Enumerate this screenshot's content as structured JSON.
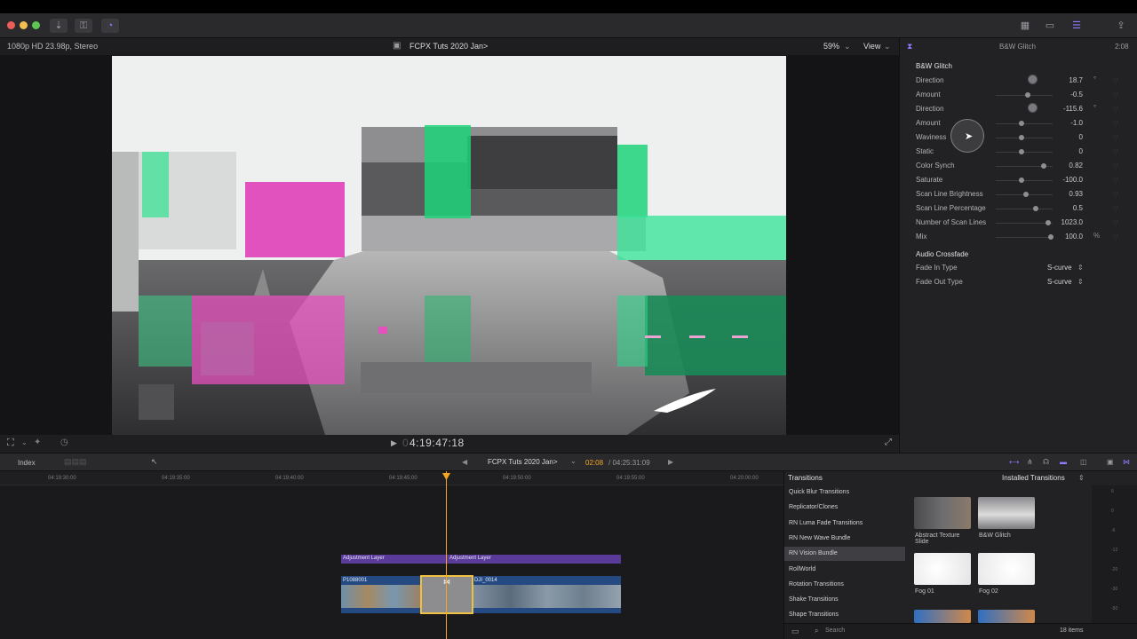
{
  "viewer": {
    "format": "1080p HD 23.98p, Stereo",
    "project_title": "FCPX Tuts 2020 Jan>",
    "zoom": "59%",
    "view_label": "View",
    "timecode": "4:19:47:18",
    "timecode_prefix": "0"
  },
  "inspector": {
    "title": "B&W Glitch",
    "duration": "2:08",
    "effect_name": "B&W Glitch",
    "params": [
      {
        "label": "Direction",
        "value": "18.7",
        "unit": "°",
        "control": "dial"
      },
      {
        "label": "Amount",
        "value": "-0.5",
        "unit": "",
        "control": "slider",
        "pos": 0.65
      },
      {
        "label": "Direction",
        "value": "-115.6",
        "unit": "°",
        "control": "dial"
      },
      {
        "label": "Amount",
        "value": "-1.0",
        "unit": "",
        "control": "slider",
        "pos": 0.5
      },
      {
        "label": "Waviness",
        "value": "0",
        "unit": "",
        "control": "slider",
        "pos": 0.5
      },
      {
        "label": "Static",
        "value": "0",
        "unit": "",
        "control": "slider",
        "pos": 0.5
      },
      {
        "label": "Color Synch",
        "value": "0.82",
        "unit": "",
        "control": "slider",
        "pos": 1.0
      },
      {
        "label": "Saturate",
        "value": "-100.0",
        "unit": "",
        "control": "slider",
        "pos": 0.5
      },
      {
        "label": "Scan Line Brightness",
        "value": "0.93",
        "unit": "",
        "control": "slider",
        "pos": 0.6
      },
      {
        "label": "Scan Line Percentage",
        "value": "0.5",
        "unit": "",
        "control": "slider",
        "pos": 0.83
      },
      {
        "label": "Number of Scan Lines",
        "value": "1023.0",
        "unit": "",
        "control": "slider",
        "pos": 1.1
      },
      {
        "label": "Mix",
        "value": "100.0",
        "unit": "%",
        "control": "slider",
        "pos": 1.15
      }
    ],
    "audio_section": "Audio Crossfade",
    "fade_in_label": "Fade In Type",
    "fade_in_value": "S-curve",
    "fade_out_label": "Fade Out Type",
    "fade_out_value": "S-curve"
  },
  "timeline": {
    "index_label": "Index",
    "project_title": "FCPX Tuts 2020 Jan>",
    "position": "02:08",
    "duration": "/ 04:25:31:09",
    "ruler": [
      "04:19:30:00",
      "04:19:35:00",
      "04:19:40:00",
      "04:19:45:00",
      "04:19:50:00",
      "04:19:55:00",
      "04:20:00:00"
    ],
    "adjustment_1": "Adjustment Layer",
    "adjustment_2": "Adjustment Layer",
    "clip_1": "P1088001",
    "clip_2": "DJI_0014"
  },
  "browser": {
    "title": "Transitions",
    "filter": "Installed Transitions",
    "categories": [
      "Quick Blur Transitions",
      "Replicator/Clones",
      "RN Luma Fade Transitions",
      "RN New Wave Bundle",
      "RN Vision Bundle",
      "RollWorld",
      "Rotation Transitions",
      "Shake Transitions",
      "Shape Transitions"
    ],
    "selected_category": "RN Vision Bundle",
    "items": [
      {
        "label": "Abstract Texture Slide"
      },
      {
        "label": "B&W Glitch"
      },
      {
        "label": "Fog 01"
      },
      {
        "label": "Fog 02"
      }
    ],
    "search_placeholder": "Search",
    "count": "18 items",
    "meter_ticks": [
      "6",
      "0",
      "-6",
      "-12",
      "-20",
      "-30",
      "-50"
    ]
  }
}
